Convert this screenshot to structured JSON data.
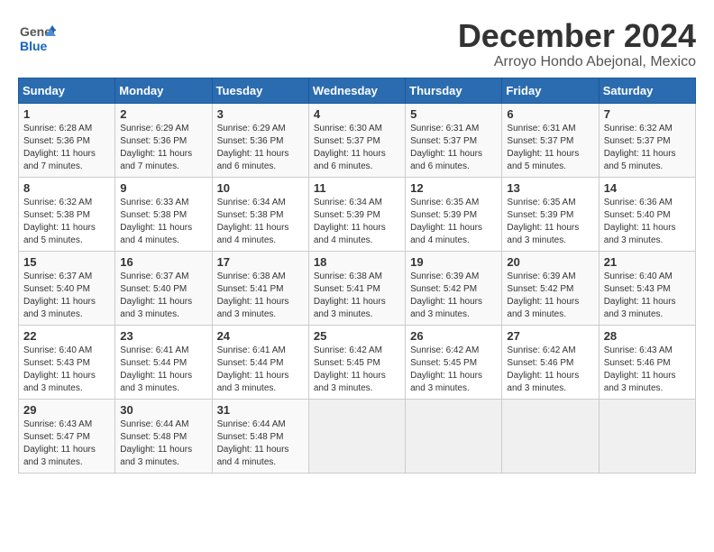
{
  "header": {
    "logo_general": "General",
    "logo_blue": "Blue",
    "month_title": "December 2024",
    "location": "Arroyo Hondo Abejonal, Mexico"
  },
  "calendar": {
    "days_of_week": [
      "Sunday",
      "Monday",
      "Tuesday",
      "Wednesday",
      "Thursday",
      "Friday",
      "Saturday"
    ],
    "weeks": [
      [
        {
          "day": "1",
          "sunrise": "6:28 AM",
          "sunset": "5:36 PM",
          "daylight": "11 hours and 7 minutes."
        },
        {
          "day": "2",
          "sunrise": "6:29 AM",
          "sunset": "5:36 PM",
          "daylight": "11 hours and 7 minutes."
        },
        {
          "day": "3",
          "sunrise": "6:29 AM",
          "sunset": "5:36 PM",
          "daylight": "11 hours and 6 minutes."
        },
        {
          "day": "4",
          "sunrise": "6:30 AM",
          "sunset": "5:37 PM",
          "daylight": "11 hours and 6 minutes."
        },
        {
          "day": "5",
          "sunrise": "6:31 AM",
          "sunset": "5:37 PM",
          "daylight": "11 hours and 6 minutes."
        },
        {
          "day": "6",
          "sunrise": "6:31 AM",
          "sunset": "5:37 PM",
          "daylight": "11 hours and 5 minutes."
        },
        {
          "day": "7",
          "sunrise": "6:32 AM",
          "sunset": "5:37 PM",
          "daylight": "11 hours and 5 minutes."
        }
      ],
      [
        {
          "day": "8",
          "sunrise": "6:32 AM",
          "sunset": "5:38 PM",
          "daylight": "11 hours and 5 minutes."
        },
        {
          "day": "9",
          "sunrise": "6:33 AM",
          "sunset": "5:38 PM",
          "daylight": "11 hours and 4 minutes."
        },
        {
          "day": "10",
          "sunrise": "6:34 AM",
          "sunset": "5:38 PM",
          "daylight": "11 hours and 4 minutes."
        },
        {
          "day": "11",
          "sunrise": "6:34 AM",
          "sunset": "5:39 PM",
          "daylight": "11 hours and 4 minutes."
        },
        {
          "day": "12",
          "sunrise": "6:35 AM",
          "sunset": "5:39 PM",
          "daylight": "11 hours and 4 minutes."
        },
        {
          "day": "13",
          "sunrise": "6:35 AM",
          "sunset": "5:39 PM",
          "daylight": "11 hours and 3 minutes."
        },
        {
          "day": "14",
          "sunrise": "6:36 AM",
          "sunset": "5:40 PM",
          "daylight": "11 hours and 3 minutes."
        }
      ],
      [
        {
          "day": "15",
          "sunrise": "6:37 AM",
          "sunset": "5:40 PM",
          "daylight": "11 hours and 3 minutes."
        },
        {
          "day": "16",
          "sunrise": "6:37 AM",
          "sunset": "5:40 PM",
          "daylight": "11 hours and 3 minutes."
        },
        {
          "day": "17",
          "sunrise": "6:38 AM",
          "sunset": "5:41 PM",
          "daylight": "11 hours and 3 minutes."
        },
        {
          "day": "18",
          "sunrise": "6:38 AM",
          "sunset": "5:41 PM",
          "daylight": "11 hours and 3 minutes."
        },
        {
          "day": "19",
          "sunrise": "6:39 AM",
          "sunset": "5:42 PM",
          "daylight": "11 hours and 3 minutes."
        },
        {
          "day": "20",
          "sunrise": "6:39 AM",
          "sunset": "5:42 PM",
          "daylight": "11 hours and 3 minutes."
        },
        {
          "day": "21",
          "sunrise": "6:40 AM",
          "sunset": "5:43 PM",
          "daylight": "11 hours and 3 minutes."
        }
      ],
      [
        {
          "day": "22",
          "sunrise": "6:40 AM",
          "sunset": "5:43 PM",
          "daylight": "11 hours and 3 minutes."
        },
        {
          "day": "23",
          "sunrise": "6:41 AM",
          "sunset": "5:44 PM",
          "daylight": "11 hours and 3 minutes."
        },
        {
          "day": "24",
          "sunrise": "6:41 AM",
          "sunset": "5:44 PM",
          "daylight": "11 hours and 3 minutes."
        },
        {
          "day": "25",
          "sunrise": "6:42 AM",
          "sunset": "5:45 PM",
          "daylight": "11 hours and 3 minutes."
        },
        {
          "day": "26",
          "sunrise": "6:42 AM",
          "sunset": "5:45 PM",
          "daylight": "11 hours and 3 minutes."
        },
        {
          "day": "27",
          "sunrise": "6:42 AM",
          "sunset": "5:46 PM",
          "daylight": "11 hours and 3 minutes."
        },
        {
          "day": "28",
          "sunrise": "6:43 AM",
          "sunset": "5:46 PM",
          "daylight": "11 hours and 3 minutes."
        }
      ],
      [
        {
          "day": "29",
          "sunrise": "6:43 AM",
          "sunset": "5:47 PM",
          "daylight": "11 hours and 3 minutes."
        },
        {
          "day": "30",
          "sunrise": "6:44 AM",
          "sunset": "5:48 PM",
          "daylight": "11 hours and 3 minutes."
        },
        {
          "day": "31",
          "sunrise": "6:44 AM",
          "sunset": "5:48 PM",
          "daylight": "11 hours and 4 minutes."
        },
        null,
        null,
        null,
        null
      ]
    ]
  }
}
